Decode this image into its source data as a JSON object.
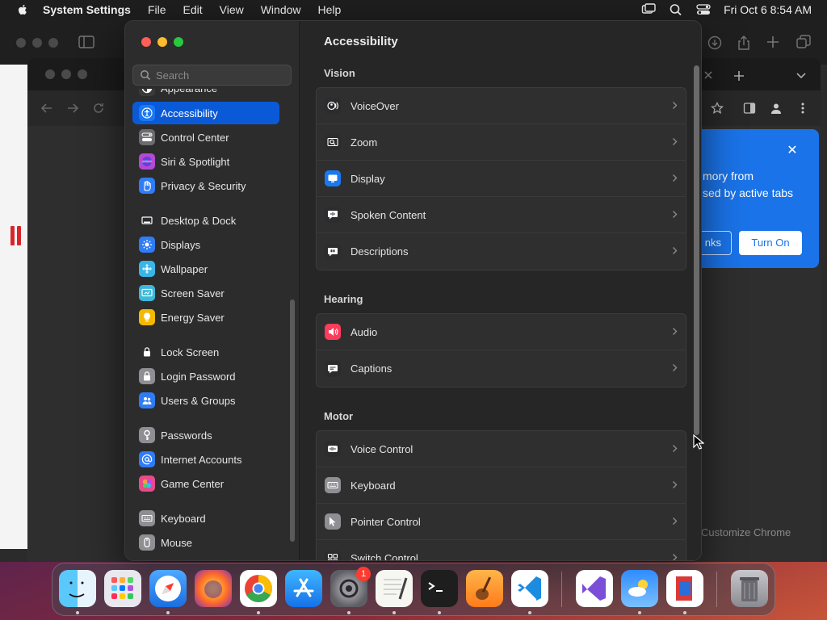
{
  "menubar": {
    "app_name": "System Settings",
    "menus": [
      "File",
      "Edit",
      "View",
      "Window",
      "Help"
    ],
    "clock": "Fri Oct 6  8:54 AM"
  },
  "browser": {
    "popup_text": "mory from\nsed by active tabs",
    "popup_left_button": "nks",
    "popup_turn_on": "Turn On",
    "customize_chrome": "Customize Chrome"
  },
  "search": {
    "placeholder": "Search"
  },
  "sidebar": {
    "items": [
      {
        "label": "Appearance",
        "icon": "appearance-icon",
        "color": "#3a3a3a"
      },
      {
        "label": "Accessibility",
        "icon": "accessibility-icon",
        "color": "#1a78f2",
        "selected": true
      },
      {
        "label": "Control Center",
        "icon": "control-center-icon",
        "color": "#6c6c70"
      },
      {
        "label": "Siri & Spotlight",
        "icon": "siri-icon",
        "color": "#b34ad6"
      },
      {
        "label": "Privacy & Security",
        "icon": "hand-icon",
        "color": "#2f7cf6"
      },
      {
        "label": "Desktop & Dock",
        "icon": "dock-icon",
        "color": "#2c2c2e"
      },
      {
        "label": "Displays",
        "icon": "displays-icon",
        "color": "#2f7cf6"
      },
      {
        "label": "Wallpaper",
        "icon": "wallpaper-icon",
        "color": "#38b6e8"
      },
      {
        "label": "Screen Saver",
        "icon": "screen-saver-icon",
        "color": "#3cb8d8"
      },
      {
        "label": "Energy Saver",
        "icon": "energy-icon",
        "color": "#f5b800"
      },
      {
        "label": "Lock Screen",
        "icon": "lock-icon",
        "color": "#2c2c2e"
      },
      {
        "label": "Login Password",
        "icon": "login-lock-icon",
        "color": "#8e8e93"
      },
      {
        "label": "Users & Groups",
        "icon": "users-icon",
        "color": "#2f7cf6"
      },
      {
        "label": "Passwords",
        "icon": "key-icon",
        "color": "#8e8e93"
      },
      {
        "label": "Internet Accounts",
        "icon": "at-icon",
        "color": "#2f7cf6"
      },
      {
        "label": "Game Center",
        "icon": "game-center-icon",
        "color": "#e84a8a"
      },
      {
        "label": "Keyboard",
        "icon": "keyboard-icon",
        "color": "#8e8e93"
      },
      {
        "label": "Mouse",
        "icon": "mouse-icon",
        "color": "#8e8e93"
      }
    ]
  },
  "main": {
    "title": "Accessibility",
    "sections": [
      {
        "label": "Vision",
        "rows": [
          {
            "label": "VoiceOver",
            "icon": "voiceover-icon",
            "color": "#2c2c2e"
          },
          {
            "label": "Zoom",
            "icon": "zoom-icon",
            "color": "#2c2c2e"
          },
          {
            "label": "Display",
            "icon": "display-icon",
            "color": "#1a78f2"
          },
          {
            "label": "Spoken Content",
            "icon": "spoken-content-icon",
            "color": "#2c2c2e"
          },
          {
            "label": "Descriptions",
            "icon": "descriptions-icon",
            "color": "#2c2c2e"
          }
        ]
      },
      {
        "label": "Hearing",
        "rows": [
          {
            "label": "Audio",
            "icon": "audio-icon",
            "color": "#ff3b5c"
          },
          {
            "label": "Captions",
            "icon": "captions-icon",
            "color": "#2c2c2e"
          }
        ]
      },
      {
        "label": "Motor",
        "rows": [
          {
            "label": "Voice Control",
            "icon": "voice-control-icon",
            "color": "#2c2c2e"
          },
          {
            "label": "Keyboard",
            "icon": "keyboard-icon",
            "color": "#8e8e93"
          },
          {
            "label": "Pointer Control",
            "icon": "pointer-icon",
            "color": "#8e8e93"
          },
          {
            "label": "Switch Control",
            "icon": "switch-control-icon",
            "color": "#2c2c2e"
          }
        ]
      }
    ]
  },
  "dock": {
    "apps": [
      {
        "name": "finder-icon"
      },
      {
        "name": "launchpad-icon"
      },
      {
        "name": "safari-icon"
      },
      {
        "name": "firefox-icon"
      },
      {
        "name": "chrome-icon"
      },
      {
        "name": "app-store-icon"
      },
      {
        "name": "system-settings-icon",
        "badge": "1"
      },
      {
        "name": "textedit-icon"
      },
      {
        "name": "terminal-icon"
      },
      {
        "name": "garageband-icon"
      },
      {
        "name": "vscode-icon"
      },
      {
        "name": "visual-studio-icon"
      },
      {
        "name": "weather-icon"
      },
      {
        "name": "remote-desktop-icon"
      },
      {
        "name": "trash-icon"
      }
    ]
  }
}
